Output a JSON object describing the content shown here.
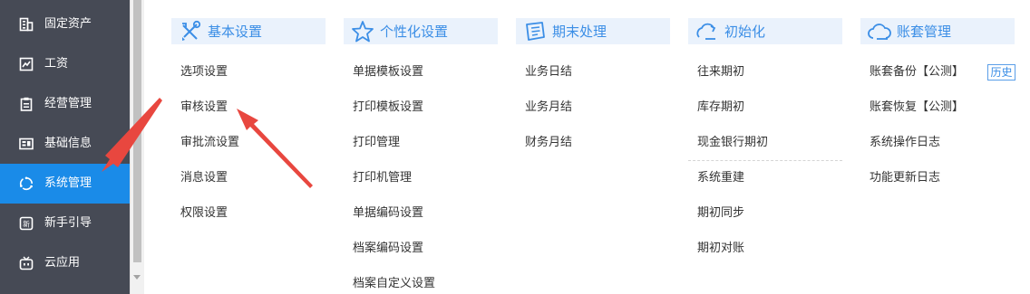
{
  "sidebar": {
    "items": [
      {
        "label": "固定资产",
        "icon": "building-icon"
      },
      {
        "label": "工资",
        "icon": "salary-icon"
      },
      {
        "label": "经营管理",
        "icon": "clipboard-icon"
      },
      {
        "label": "基础信息",
        "icon": "id-card-icon"
      },
      {
        "label": "系统管理",
        "icon": "system-ring-icon",
        "active": true
      },
      {
        "label": "新手引导",
        "icon": "new-guide-icon"
      },
      {
        "label": "云应用",
        "icon": "tv-icon"
      }
    ],
    "active_color": "#1a8be8",
    "bg_color": "#464a55"
  },
  "columns": [
    {
      "title": "基本设置",
      "icon": "tools-icon",
      "items": [
        "选项设置",
        "审核设置",
        "审批流设置",
        "消息设置",
        "权限设置"
      ]
    },
    {
      "title": "个性化设置",
      "icon": "star-icon",
      "items": [
        "单据模板设置",
        "打印模板设置",
        "打印管理",
        "打印机管理",
        "单据编码设置",
        "档案编码设置",
        "档案自定义设置"
      ]
    },
    {
      "title": "期末处理",
      "icon": "ticket-icon",
      "items": [
        "业务日结",
        "业务月结",
        "财务月结"
      ]
    },
    {
      "title": "初始化",
      "icon": "refresh-cloud-icon",
      "items": [
        "往来期初",
        "库存期初",
        "现金银行期初",
        "系统重建",
        "期初同步",
        "期初对账"
      ]
    },
    {
      "title": "账套管理",
      "icon": "cloud-icon",
      "items": [
        "账套备份【公测】",
        "账套恢复【公测】",
        "系统操作日志",
        "功能更新日志"
      ]
    }
  ],
  "history_badge": "历史",
  "accent_color": "#3b8ee6",
  "annotation_color": "#e8473f"
}
